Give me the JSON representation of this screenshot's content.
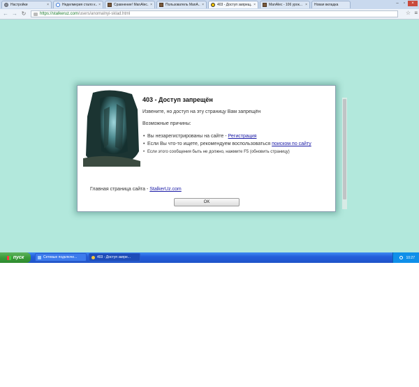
{
  "browser": {
    "tabs": [
      {
        "label": "Настройки",
        "icon": "gear-icon",
        "active": false
      },
      {
        "label": "Неделмерия стало к...",
        "icon": "google-icon",
        "active": false
      },
      {
        "label": "Сравнение! ManAlec...",
        "icon": "site-icon",
        "active": false
      },
      {
        "label": "Пользователь ManA...",
        "icon": "site-icon",
        "active": false
      },
      {
        "label": "403 - Доступ запрещ...",
        "icon": "radiation-icon",
        "active": true
      },
      {
        "label": "ManAlec - 106 урок...",
        "icon": "site-icon",
        "active": false
      },
      {
        "label": "Новая вкладка",
        "icon": "",
        "active": false
      }
    ],
    "url_host": "https://stalkeruz.com",
    "url_path": "/users/anomalnyi-sklad.html"
  },
  "dialog": {
    "title": "403 - Доступ запрещён",
    "message": "Извените, но доступ на эту страницу Вам запрещён",
    "reasons_heading": "Возможные причины:",
    "reason1_text": "Вы незарегистрированы на сайте - ",
    "reason1_link": "Регистрация",
    "reason2_text": "Если Вы что-то ищете, рекомендуем воспользоваться ",
    "reason2_link": "поиском по сайту",
    "reason3_text": "Если этого сообщения быть не должно, нажмите F5 (обновить страницу)",
    "home_text": "Главная страница сайта - ",
    "home_link": "StalkerUz.com",
    "ok_label": "OK"
  },
  "taskbar": {
    "start_label": "пуск",
    "items": [
      {
        "label": "Сетевые подключе...",
        "active": false
      },
      {
        "label": "403 - Доступ запре...",
        "active": true
      }
    ],
    "clock": "10:27"
  },
  "colors": {
    "page_background": "#b2e8dc",
    "taskbar": "#245edb",
    "start_button": "#3a9b3a",
    "link": "#1a1aa6"
  }
}
